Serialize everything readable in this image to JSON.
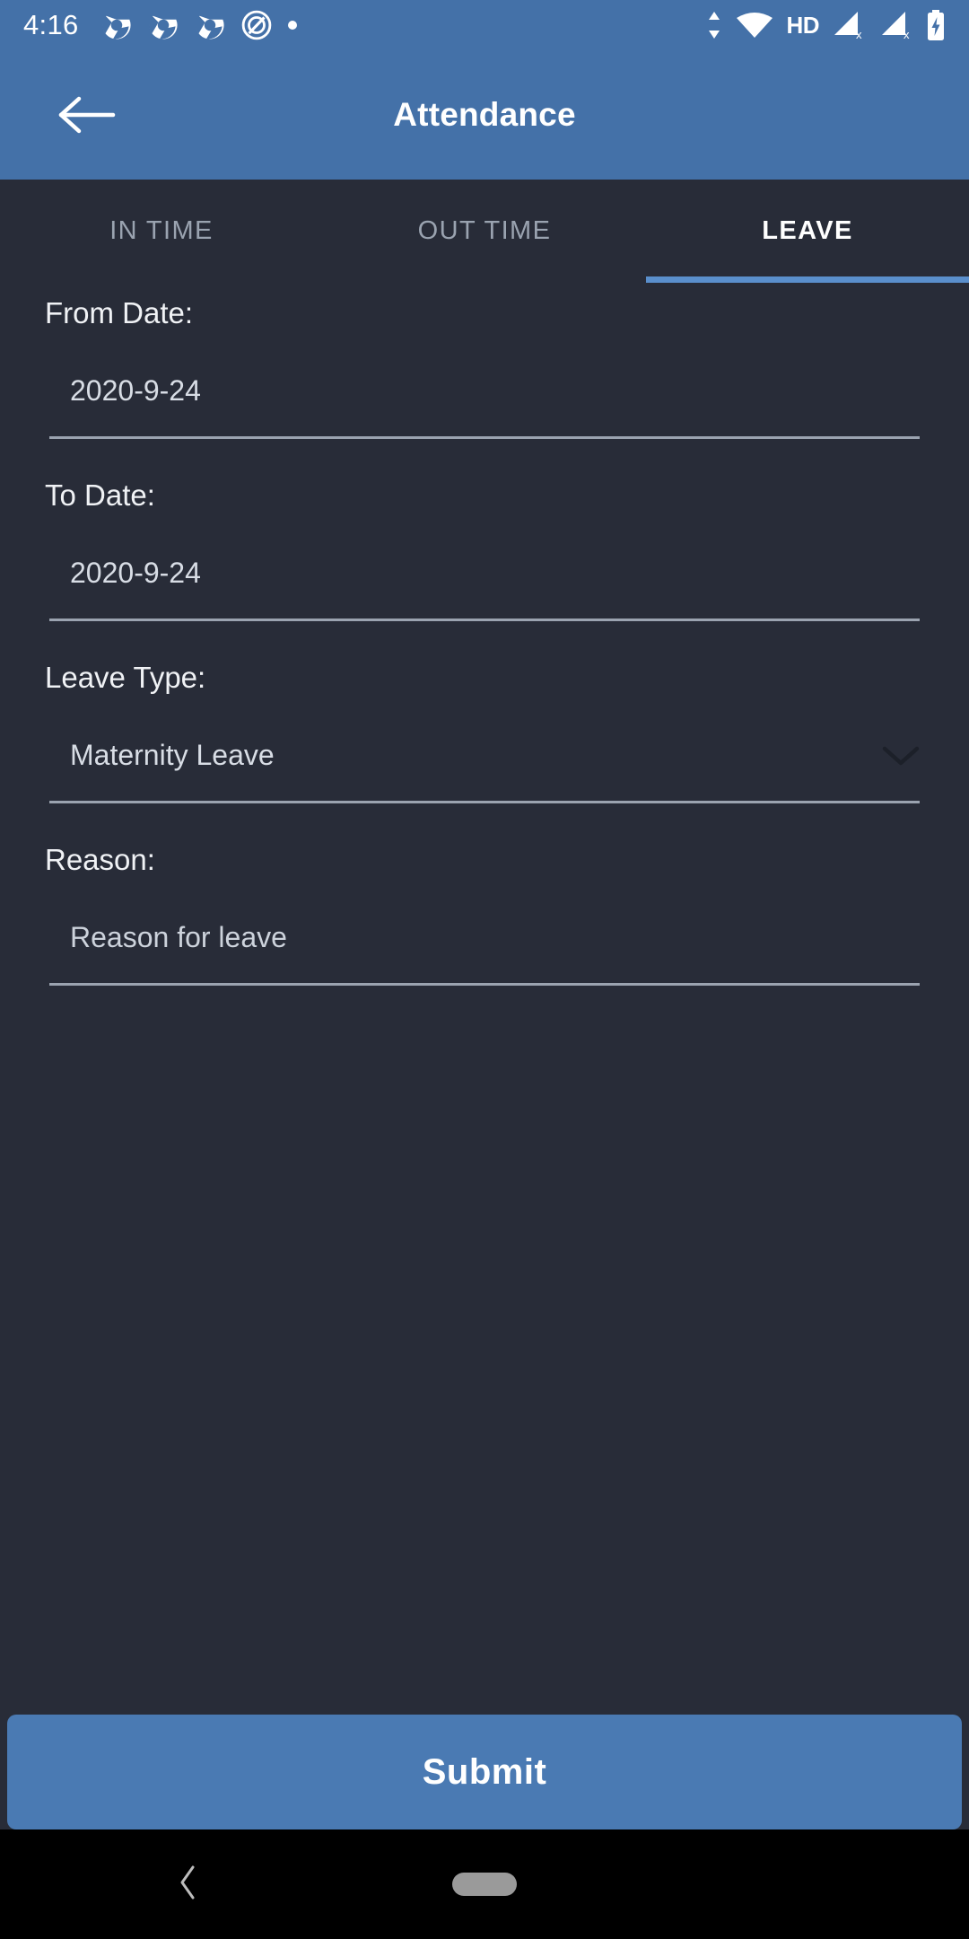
{
  "status_bar": {
    "time": "4:16",
    "left_icons": [
      "chrome-icon",
      "chrome-icon",
      "chrome-icon",
      "circle-slash-icon",
      "dot-icon"
    ],
    "right_icons": [
      "data-transfer-icon",
      "wifi-icon",
      "hd-label",
      "signal-no-sim-icon",
      "signal-no-sim-icon",
      "battery-charging-icon"
    ],
    "hd_label": "HD",
    "background": "#4471a8"
  },
  "app_bar": {
    "title": "Attendance",
    "back_icon": "arrow-left-icon",
    "background": "#4471a8"
  },
  "tabs": {
    "items": [
      {
        "label": "IN TIME",
        "active": false
      },
      {
        "label": "OUT TIME",
        "active": false
      },
      {
        "label": "LEAVE",
        "active": true
      }
    ],
    "indicator_color": "#5a8fcc"
  },
  "form": {
    "from_date": {
      "label": "From Date:",
      "value": "2020-9-24"
    },
    "to_date": {
      "label": "To Date:",
      "value": "2020-9-24"
    },
    "leave_type": {
      "label": "Leave Type:",
      "value": "Maternity Leave",
      "dropdown_icon": "chevron-down-icon"
    },
    "reason": {
      "label": "Reason:",
      "placeholder": "Reason for leave"
    }
  },
  "submit": {
    "label": "Submit",
    "color": "#4a7ab3"
  },
  "nav_bar": {
    "back_icon": "chevron-left-icon",
    "home_pill": "home-indicator"
  },
  "theme": {
    "background": "#282c38",
    "accent": "#4471a8",
    "text_primary": "#f0f2f5",
    "text_secondary": "#9aa3b0"
  }
}
